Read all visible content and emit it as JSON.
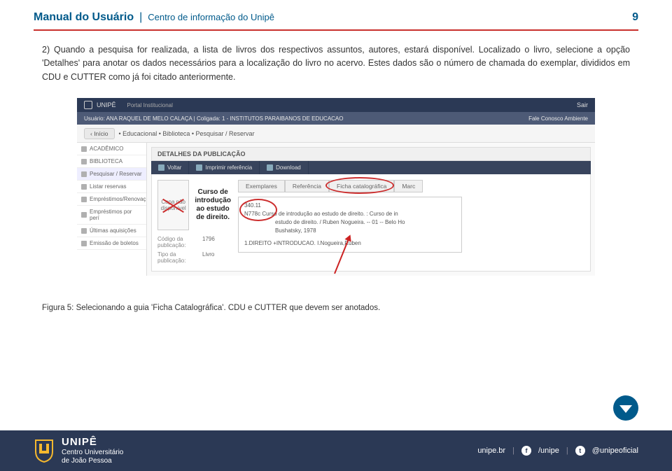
{
  "header": {
    "title": "Manual do Usuário",
    "subtitle": "Centro de informação do Unipê",
    "page": "9"
  },
  "body": {
    "paragraph": "2) Quando a pesquisa for realizada, a lista de livros dos respectivos assuntos, autores, estará disponível. Localizado o livro, selecione a opção 'Detalhes' para anotar os dados necessários para a localização do livro no acervo. Estes dados são o número de chamada do exemplar, divididos em CDU e CUTTER como já foi citado anteriormente."
  },
  "screenshot": {
    "topbar": {
      "brand": "UNIPÊ",
      "portal": "Portal Institucional",
      "sair": "Sair"
    },
    "userbar": {
      "left": "Usuário: ANA RAQUEL DE MELO CALAÇA  |  Coligada: 1 - INSTITUTOS PARAIBANOS DE EDUCACAO",
      "right": "Fale Conosco   Ambiente"
    },
    "breadcrumb": {
      "inicio": "‹ Início",
      "path": "• Educacional • Biblioteca • Pesquisar / Reservar"
    },
    "sidebar": {
      "items": [
        "ACADÊMICO",
        "BIBLIOTECA",
        "Pesquisar / Reservar",
        "Listar reservas",
        "Empréstimos/Renovaç",
        "Empréstimos por perí",
        "Últimas aquisições",
        "Emissão de boletos"
      ]
    },
    "panel_title": "DETALHES DA PUBLICAÇÃO",
    "toolbar": {
      "voltar": "Voltar",
      "imprimir": "Imprimir referência",
      "download": "Download"
    },
    "thumb_text": "Capa não disponível",
    "book_title": "Curso de introdução ao estudo de direito.",
    "meta": {
      "codigo_label": "Código da publicação:",
      "codigo_value": "1796",
      "tipo_label": "Tipo da publicação:",
      "tipo_value": "Livro"
    },
    "tabs": [
      "Exemplares",
      "Referência",
      "Ficha catalográfica",
      "Marc"
    ],
    "card": {
      "line1": "340.11",
      "line2": "N778c   Curso de introdução ao estudo de direito. : Curso de in",
      "line3": "estudo de direito. / Ruben Nogueira. -- 01 -- Belo Ho",
      "line4": "Bushatsky, 1978",
      "line5": "1.DIREITO +INTRODUCAO. I.Nogueira,Ruben"
    }
  },
  "caption": "Figura 5: Selecionando a guia 'Ficha Catalográfica'. CDU e CUTTER que devem ser anotados.",
  "footer": {
    "brand": "UNIPÊ",
    "tagline1": "Centro Universitário",
    "tagline2": "de João Pessoa",
    "site": "unipe.br",
    "fb": "/unipe",
    "tw": "@unipeoficial"
  }
}
